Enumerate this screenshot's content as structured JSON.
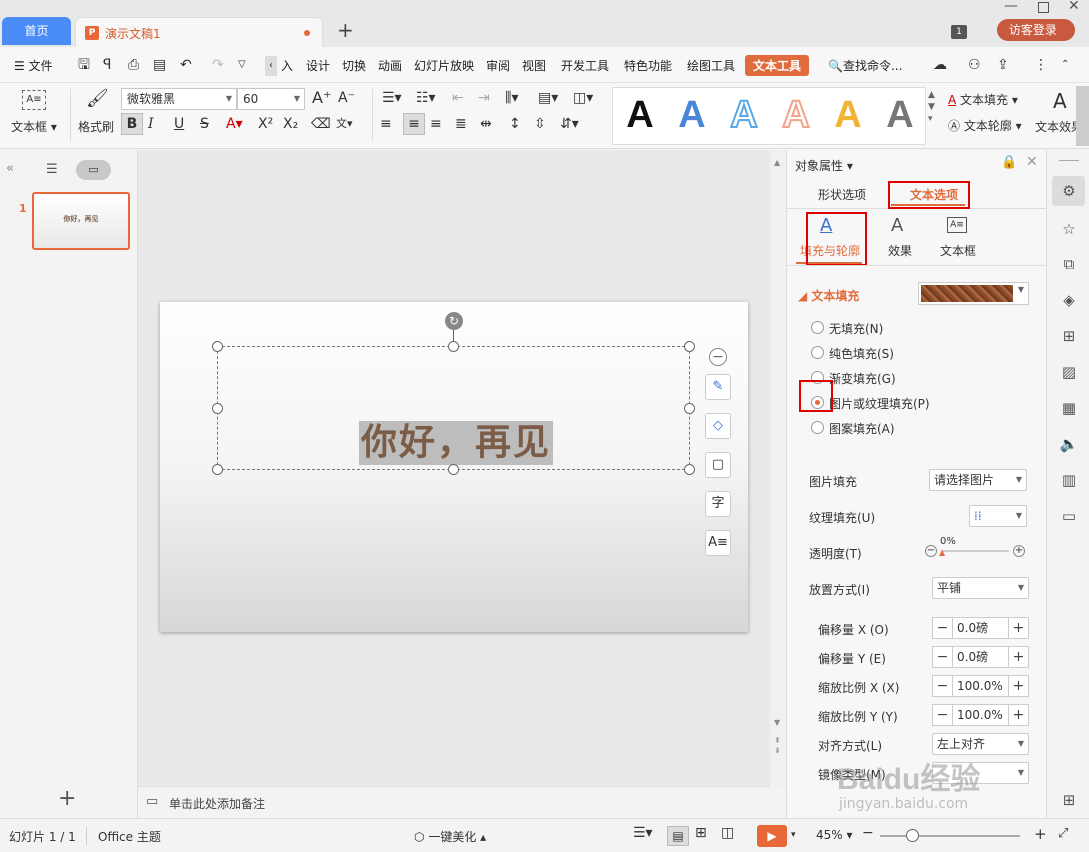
{
  "tabs": {
    "home": "首页",
    "doc": "演示文稿1",
    "login": "访客登录"
  },
  "menu": {
    "file": "文件",
    "items": [
      "入",
      "设计",
      "切换",
      "动画",
      "幻灯片放映",
      "审阅",
      "视图",
      "开发工具",
      "特色功能",
      "绘图工具",
      "文本工具"
    ],
    "search": "查找命令..."
  },
  "ribbon": {
    "textbox": "文本框",
    "format_painter": "格式刷",
    "font_name": "微软雅黑",
    "font_size": "60",
    "text_fill": "文本填充",
    "text_outline": "文本轮廓",
    "text_effect": "文本效果",
    "wordart_colors": [
      "#111111",
      "#4a86d8",
      "#5aa9e6",
      "#f2a488",
      "#f2b233",
      "#777777"
    ]
  },
  "slide": {
    "number": "1",
    "thumb_text": "你好，再见",
    "text": "你好，再见"
  },
  "notes": {
    "placeholder": "单击此处添加备注"
  },
  "panel": {
    "title": "对象属性",
    "tabs": [
      "形状选项",
      "文本选项"
    ],
    "subtabs": [
      "填充与轮廓",
      "效果",
      "文本框"
    ],
    "section": "文本填充",
    "radios": [
      "无填充(N)",
      "纯色填充(S)",
      "渐变填充(G)",
      "图片或纹理填充(P)",
      "图案填充(A)"
    ],
    "selected_radio": 3,
    "picture_fill_label": "图片填充",
    "picture_fill_value": "请选择图片",
    "texture_fill_label": "纹理填充(U)",
    "transparency_label": "透明度(T)",
    "transparency_value": "0%",
    "placement_label": "放置方式(I)",
    "placement_value": "平铺",
    "offset_x_label": "偏移量 X (O)",
    "offset_x_value": "0.0磅",
    "offset_y_label": "偏移量 Y (E)",
    "offset_y_value": "0.0磅",
    "scale_x_label": "缩放比例 X (X)",
    "scale_x_value": "100.0%",
    "scale_y_label": "缩放比例 Y (Y)",
    "scale_y_value": "100.0%",
    "align_label": "对齐方式(L)",
    "align_value": "左上对齐",
    "mirror_label": "镜像类型(M)"
  },
  "status": {
    "slide_info": "幻灯片 1 / 1",
    "theme": "Office 主题",
    "beautify": "一键美化",
    "zoom": "45%"
  },
  "watermark": {
    "brand": "Baidu经验",
    "url": "jingyan.baidu.com"
  },
  "colors": {
    "accent": "#e06c3d",
    "blue_tab": "#4a8cf7",
    "red_highlight": "#e00000"
  }
}
